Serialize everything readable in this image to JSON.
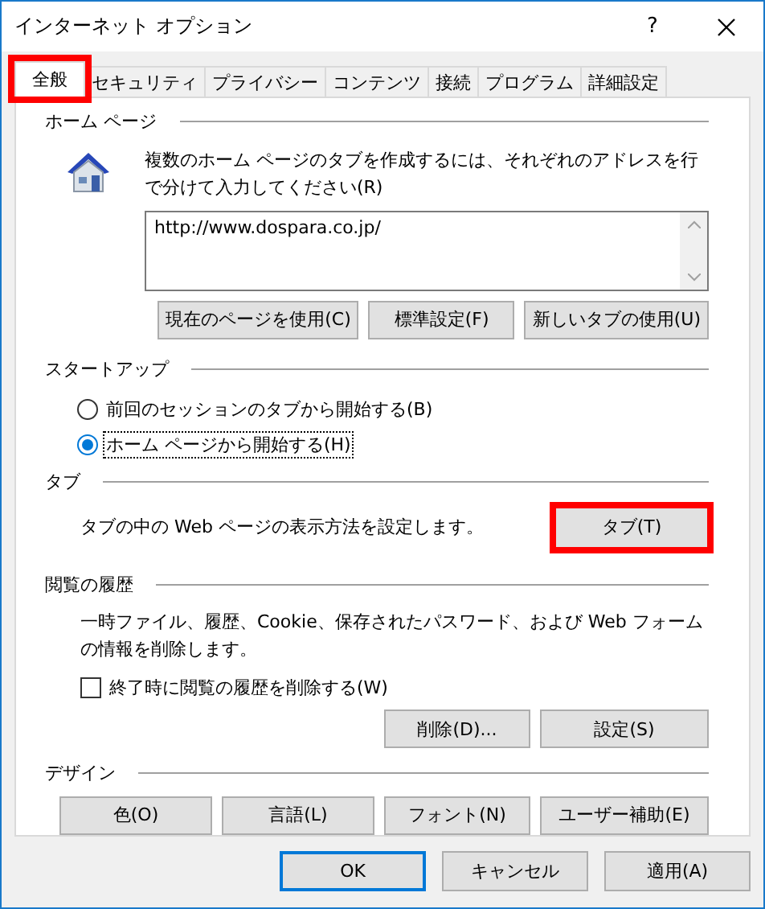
{
  "window": {
    "title": "インターネット オプション",
    "help": "?"
  },
  "tabs": [
    {
      "label": "全般",
      "selected": true,
      "highlighted": true
    },
    {
      "label": "セキュリティ",
      "selected": false,
      "highlighted": false
    },
    {
      "label": "プライバシー",
      "selected": false,
      "highlighted": false
    },
    {
      "label": "コンテンツ",
      "selected": false,
      "highlighted": false
    },
    {
      "label": "接続",
      "selected": false,
      "highlighted": false
    },
    {
      "label": "プログラム",
      "selected": false,
      "highlighted": false
    },
    {
      "label": "詳細設定",
      "selected": false,
      "highlighted": false
    }
  ],
  "home_page": {
    "heading": "ホーム ページ",
    "description": "複数のホーム ページのタブを作成するには、それぞれのアドレスを行で分けて入力してください(R)",
    "addresses": "http://www.dospara.co.jp/",
    "buttons": [
      {
        "label": "現在のページを使用(C)",
        "highlighted": false
      },
      {
        "label": "標準設定(F)",
        "highlighted": false
      },
      {
        "label": "新しいタブの使用(U)",
        "highlighted": false
      }
    ]
  },
  "startup": {
    "heading": "スタートアップ",
    "options": [
      {
        "label": "前回のセッションのタブから開始する(B)",
        "selected": false,
        "focused": false
      },
      {
        "label": "ホーム ページから開始する(H)",
        "selected": true,
        "focused": true
      }
    ]
  },
  "tabs_section": {
    "heading": "タブ",
    "description": "タブの中の Web ページの表示方法を設定します。",
    "buttons": [
      {
        "label": "タブ(T)",
        "highlighted": true
      }
    ]
  },
  "history": {
    "heading": "閲覧の履歴",
    "description": "一時ファイル、履歴、Cookie、保存されたパスワード、および Web フォームの情報を削除します。",
    "delete_on_exit": {
      "label": "終了時に閲覧の履歴を削除する(W)",
      "checked": false
    },
    "buttons": [
      {
        "label": "削除(D)...",
        "highlighted": false
      },
      {
        "label": "設定(S)",
        "highlighted": false
      }
    ]
  },
  "design": {
    "heading": "デザイン",
    "buttons": [
      {
        "label": "色(O)",
        "highlighted": false
      },
      {
        "label": "言語(L)",
        "highlighted": false
      },
      {
        "label": "フォント(N)",
        "highlighted": false
      },
      {
        "label": "ユーザー補助(E)",
        "highlighted": false
      }
    ]
  },
  "dialog_buttons": [
    {
      "label": "OK",
      "default": true
    },
    {
      "label": "キャンセル",
      "default": false
    },
    {
      "label": "適用(A)",
      "default": false
    }
  ]
}
